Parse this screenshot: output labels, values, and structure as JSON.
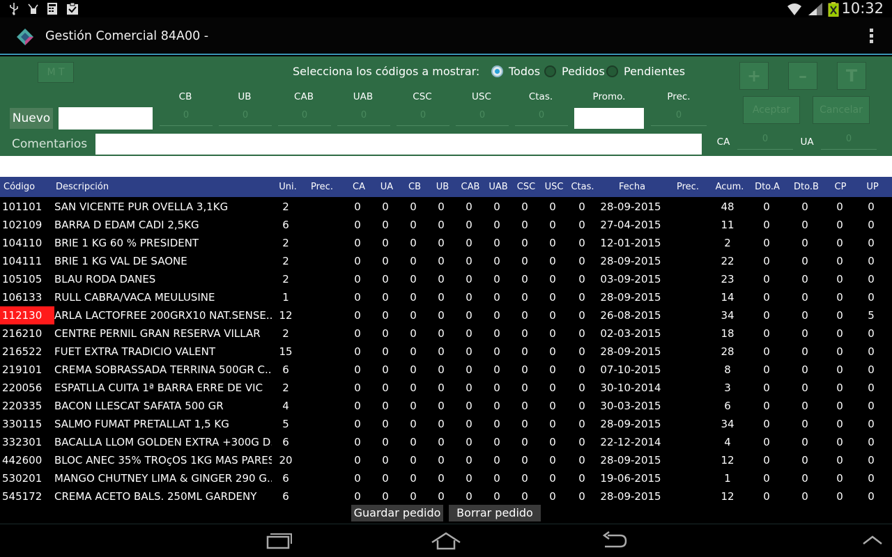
{
  "status": {
    "time": "10:32"
  },
  "app": {
    "title": "Gestión Comercial 84A00 -"
  },
  "panel": {
    "mt_label": "M T",
    "select_label": "Selecciona los códigos a mostrar:",
    "radios": [
      {
        "label": "Todos",
        "checked": true
      },
      {
        "label": "Pedidos",
        "checked": false
      },
      {
        "label": "Pendientes",
        "checked": false
      }
    ],
    "plus_label": "+",
    "minus_label": "–",
    "t_label": "T",
    "aceptar_label": "Aceptar",
    "cancelar_label": "Cancelar",
    "nuevo_label": "Nuevo",
    "comentarios_label": "Comentarios",
    "fields": [
      {
        "label": "CB",
        "value": "0"
      },
      {
        "label": "UB",
        "value": "0"
      },
      {
        "label": "CAB",
        "value": "0"
      },
      {
        "label": "UAB",
        "value": "0"
      },
      {
        "label": "CSC",
        "value": "0"
      },
      {
        "label": "USC",
        "value": "0"
      },
      {
        "label": "Ctas.",
        "value": "0"
      },
      {
        "label": "Promo.",
        "value": ""
      },
      {
        "label": "Prec.",
        "value": "0"
      }
    ],
    "ca_label": "CA",
    "ca_value": "0",
    "ua_label": "UA",
    "ua_value": "0"
  },
  "table": {
    "headers": [
      "Código",
      "Descripción",
      "Uni.",
      "Prec.",
      "CA",
      "UA",
      "CB",
      "UB",
      "CAB",
      "UAB",
      "CSC",
      "USC",
      "Ctas.",
      "Fecha",
      "Prec.",
      "Acum.",
      "Dto.A",
      "Dto.B",
      "CP",
      "UP"
    ],
    "rows": [
      {
        "codigo": "101101",
        "desc": "SAN VICENTE PUR OVELLA 3,1KG",
        "uni": "2",
        "ca": "0",
        "ua": "0",
        "cb": "0",
        "ub": "0",
        "cab": "0",
        "uab": "0",
        "csc": "0",
        "usc": "0",
        "ctas": "0",
        "fecha": "28-09-2015",
        "acum": "48",
        "dtoa": "0",
        "dtob": "0",
        "cp": "0",
        "up": "0",
        "highlight": false
      },
      {
        "codigo": "102109",
        "desc": "BARRA D EDAM CADI 2,5KG",
        "uni": "6",
        "ca": "0",
        "ua": "0",
        "cb": "0",
        "ub": "0",
        "cab": "0",
        "uab": "0",
        "csc": "0",
        "usc": "0",
        "ctas": "0",
        "fecha": "27-04-2015",
        "acum": "11",
        "dtoa": "0",
        "dtob": "0",
        "cp": "0",
        "up": "0",
        "highlight": false
      },
      {
        "codigo": "104110",
        "desc": "BRIE 1 KG 60 % PRESIDENT",
        "uni": "2",
        "ca": "0",
        "ua": "0",
        "cb": "0",
        "ub": "0",
        "cab": "0",
        "uab": "0",
        "csc": "0",
        "usc": "0",
        "ctas": "0",
        "fecha": "12-01-2015",
        "acum": "2",
        "dtoa": "0",
        "dtob": "0",
        "cp": "0",
        "up": "0",
        "highlight": false
      },
      {
        "codigo": "104111",
        "desc": "BRIE 1 KG VAL DE SAONE",
        "uni": "2",
        "ca": "0",
        "ua": "0",
        "cb": "0",
        "ub": "0",
        "cab": "0",
        "uab": "0",
        "csc": "0",
        "usc": "0",
        "ctas": "0",
        "fecha": "28-09-2015",
        "acum": "22",
        "dtoa": "0",
        "dtob": "0",
        "cp": "0",
        "up": "0",
        "highlight": false
      },
      {
        "codigo": "105105",
        "desc": "BLAU RODA DANES",
        "uni": "2",
        "ca": "0",
        "ua": "0",
        "cb": "0",
        "ub": "0",
        "cab": "0",
        "uab": "0",
        "csc": "0",
        "usc": "0",
        "ctas": "0",
        "fecha": "03-09-2015",
        "acum": "23",
        "dtoa": "0",
        "dtob": "0",
        "cp": "0",
        "up": "0",
        "highlight": false
      },
      {
        "codigo": "106133",
        "desc": "RULL CABRA/VACA MEULUSINE",
        "uni": "1",
        "ca": "0",
        "ua": "0",
        "cb": "0",
        "ub": "0",
        "cab": "0",
        "uab": "0",
        "csc": "0",
        "usc": "0",
        "ctas": "0",
        "fecha": "28-09-2015",
        "acum": "14",
        "dtoa": "0",
        "dtob": "0",
        "cp": "0",
        "up": "0",
        "highlight": false
      },
      {
        "codigo": "112130",
        "desc": "ARLA LACTOFREE 200GRX10 NAT.SENSE...",
        "uni": "12",
        "ca": "0",
        "ua": "0",
        "cb": "0",
        "ub": "0",
        "cab": "0",
        "uab": "0",
        "csc": "0",
        "usc": "0",
        "ctas": "0",
        "fecha": "26-08-2015",
        "acum": "34",
        "dtoa": "0",
        "dtob": "0",
        "cp": "0",
        "up": "5",
        "highlight": true
      },
      {
        "codigo": "216210",
        "desc": "CENTRE PERNIL GRAN RESERVA VILLAR",
        "uni": "2",
        "ca": "0",
        "ua": "0",
        "cb": "0",
        "ub": "0",
        "cab": "0",
        "uab": "0",
        "csc": "0",
        "usc": "0",
        "ctas": "0",
        "fecha": "02-03-2015",
        "acum": "18",
        "dtoa": "0",
        "dtob": "0",
        "cp": "0",
        "up": "0",
        "highlight": false
      },
      {
        "codigo": "216522",
        "desc": "FUET EXTRA TRADICIO VALENT",
        "uni": "15",
        "ca": "0",
        "ua": "0",
        "cb": "0",
        "ub": "0",
        "cab": "0",
        "uab": "0",
        "csc": "0",
        "usc": "0",
        "ctas": "0",
        "fecha": "28-09-2015",
        "acum": "28",
        "dtoa": "0",
        "dtob": "0",
        "cp": "0",
        "up": "0",
        "highlight": false
      },
      {
        "codigo": "219101",
        "desc": "CREMA SOBRASSADA TERRINA 500GR C...",
        "uni": "6",
        "ca": "0",
        "ua": "0",
        "cb": "0",
        "ub": "0",
        "cab": "0",
        "uab": "0",
        "csc": "0",
        "usc": "0",
        "ctas": "0",
        "fecha": "07-10-2015",
        "acum": "8",
        "dtoa": "0",
        "dtob": "0",
        "cp": "0",
        "up": "0",
        "highlight": false
      },
      {
        "codigo": "220056",
        "desc": "ESPATLLA CUITA 1ª BARRA ERRE DE VIC",
        "uni": "2",
        "ca": "0",
        "ua": "0",
        "cb": "0",
        "ub": "0",
        "cab": "0",
        "uab": "0",
        "csc": "0",
        "usc": "0",
        "ctas": "0",
        "fecha": "30-10-2014",
        "acum": "3",
        "dtoa": "0",
        "dtob": "0",
        "cp": "0",
        "up": "0",
        "highlight": false
      },
      {
        "codigo": "220335",
        "desc": "BACON LLESCAT SAFATA 500 GR",
        "uni": "4",
        "ca": "0",
        "ua": "0",
        "cb": "0",
        "ub": "0",
        "cab": "0",
        "uab": "0",
        "csc": "0",
        "usc": "0",
        "ctas": "0",
        "fecha": "30-03-2015",
        "acum": "6",
        "dtoa": "0",
        "dtob": "0",
        "cp": "0",
        "up": "0",
        "highlight": false
      },
      {
        "codigo": "330115",
        "desc": "SALMO FUMAT PRETALLAT 1,5 KG",
        "uni": "5",
        "ca": "0",
        "ua": "0",
        "cb": "0",
        "ub": "0",
        "cab": "0",
        "uab": "0",
        "csc": "0",
        "usc": "0",
        "ctas": "0",
        "fecha": "28-09-2015",
        "acum": "34",
        "dtoa": "0",
        "dtob": "0",
        "cp": "0",
        "up": "0",
        "highlight": false
      },
      {
        "codigo": "332301",
        "desc": "BACALLA LLOM GOLDEN EXTRA +300G D...",
        "uni": "6",
        "ca": "0",
        "ua": "0",
        "cb": "0",
        "ub": "0",
        "cab": "0",
        "uab": "0",
        "csc": "0",
        "usc": "0",
        "ctas": "0",
        "fecha": "22-12-2014",
        "acum": "4",
        "dtoa": "0",
        "dtob": "0",
        "cp": "0",
        "up": "0",
        "highlight": false
      },
      {
        "codigo": "442600",
        "desc": "BLOC ANEC 35% TROçOS 1KG MAS PARES",
        "uni": "20",
        "ca": "0",
        "ua": "0",
        "cb": "0",
        "ub": "0",
        "cab": "0",
        "uab": "0",
        "csc": "0",
        "usc": "0",
        "ctas": "0",
        "fecha": "28-09-2015",
        "acum": "12",
        "dtoa": "0",
        "dtob": "0",
        "cp": "0",
        "up": "0",
        "highlight": false
      },
      {
        "codigo": "530201",
        "desc": "MANGO CHUTNEY LIMA & GINGER 290 G...",
        "uni": "6",
        "ca": "0",
        "ua": "0",
        "cb": "0",
        "ub": "0",
        "cab": "0",
        "uab": "0",
        "csc": "0",
        "usc": "0",
        "ctas": "0",
        "fecha": "19-06-2015",
        "acum": "1",
        "dtoa": "0",
        "dtob": "0",
        "cp": "0",
        "up": "0",
        "highlight": false
      },
      {
        "codigo": "545172",
        "desc": "CREMA ACETO BALS. 250ML GARDENY",
        "uni": "6",
        "ca": "0",
        "ua": "0",
        "cb": "0",
        "ub": "0",
        "cab": "0",
        "uab": "0",
        "csc": "0",
        "usc": "0",
        "ctas": "0",
        "fecha": "28-09-2015",
        "acum": "12",
        "dtoa": "0",
        "dtob": "0",
        "cp": "0",
        "up": "0",
        "highlight": false
      }
    ]
  },
  "actions": {
    "save_label": "Guardar pedido",
    "delete_label": "Borrar pedido"
  },
  "colors": {
    "panel": "#2e6b44",
    "header": "#2d3f86",
    "highlight": "#ff1a1a",
    "accent": "#3b95b4"
  }
}
